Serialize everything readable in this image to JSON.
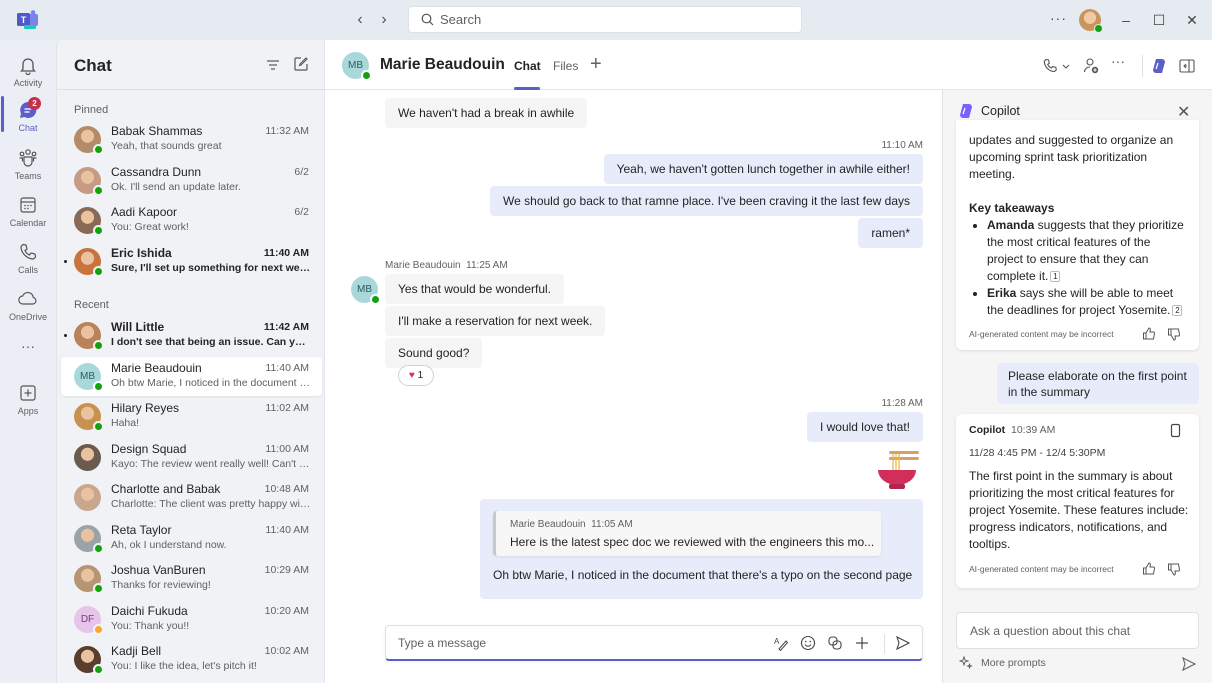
{
  "titlebar": {
    "search_placeholder": "Search",
    "more_label": "···"
  },
  "rail": {
    "items": [
      {
        "id": "activity",
        "label": "Activity",
        "icon": "bell-icon"
      },
      {
        "id": "chat",
        "label": "Chat",
        "icon": "chat-icon",
        "badge": "2",
        "active": true
      },
      {
        "id": "teams",
        "label": "Teams",
        "icon": "teams-icon"
      },
      {
        "id": "calendar",
        "label": "Calendar",
        "icon": "calendar-icon"
      },
      {
        "id": "calls",
        "label": "Calls",
        "icon": "phone-icon"
      },
      {
        "id": "onedrive",
        "label": "OneDrive",
        "icon": "cloud-icon"
      },
      {
        "id": "more",
        "label": "···",
        "icon": "more-icon"
      },
      {
        "id": "apps",
        "label": "Apps",
        "icon": "apps-icon"
      }
    ]
  },
  "chatlist": {
    "title": "Chat",
    "pinned_label": "Pinned",
    "recent_label": "Recent",
    "pinned": [
      {
        "name": "Babak Shammas",
        "time": "11:32 AM",
        "preview": "Yeah, that sounds great",
        "presence": "available"
      },
      {
        "name": "Cassandra Dunn",
        "time": "6/2",
        "preview": "Ok. I'll send an update later.",
        "presence": "available"
      },
      {
        "name": "Aadi Kapoor",
        "time": "6/2",
        "preview": "You: Great work!",
        "presence": "available"
      },
      {
        "name": "Eric Ishida",
        "time": "11:40 AM",
        "preview": "Sure, I'll set up something for next week t...",
        "presence": "available",
        "unread": true
      }
    ],
    "recent": [
      {
        "name": "Will Little",
        "time": "11:42 AM",
        "preview": "I don't see that being an issue. Can you ta...",
        "presence": "available",
        "unread": true
      },
      {
        "name": "Marie Beaudouin",
        "time": "11:40 AM",
        "preview": "Oh btw Marie, I noticed in the document t...",
        "presence": "available",
        "initials": "MB",
        "selected": true
      },
      {
        "name": "Hilary Reyes",
        "time": "11:02 AM",
        "preview": "Haha!",
        "presence": "available"
      },
      {
        "name": "Design Squad",
        "time": "11:00 AM",
        "preview": "Kayo: The review went really well! Can't wai...",
        "presence": "none"
      },
      {
        "name": "Charlotte and Babak",
        "time": "10:48 AM",
        "preview": "Charlotte: The client was pretty happy with...",
        "presence": "none"
      },
      {
        "name": "Reta Taylor",
        "time": "11:40 AM",
        "preview": "Ah, ok I understand now.",
        "presence": "available"
      },
      {
        "name": "Joshua VanBuren",
        "time": "10:29 AM",
        "preview": "Thanks for reviewing!",
        "presence": "available"
      },
      {
        "name": "Daichi Fukuda",
        "time": "10:20 AM",
        "preview": "You: Thank you!!",
        "presence": "away",
        "initials": "DF"
      },
      {
        "name": "Kadji Bell",
        "time": "10:02 AM",
        "preview": "You: I like the idea, let's pitch it!",
        "presence": "available"
      }
    ]
  },
  "conversation": {
    "contact_name": "Marie Beaudouin",
    "contact_initials": "MB",
    "tabs": [
      "Chat",
      "Files"
    ],
    "active_tab": "Chat",
    "messages": {
      "m1": "We haven't had a break in awhile",
      "ts1": "11:10 AM",
      "m2": "Yeah, we haven't gotten lunch together in awhile either!",
      "m3": "We should go back to that ramne place. I've been craving it the last few days",
      "m4": "ramen*",
      "sender2": "Marie Beaudouin",
      "ts2": "11:25 AM",
      "m5": "Yes that would be wonderful.",
      "m6": "I'll make a reservation for next week.",
      "m7": "Sound good?",
      "reaction_count": "1",
      "ts3": "11:28 AM",
      "m8": "I would love that!",
      "quote_sender": "Marie Beaudouin",
      "quote_time": "11:05 AM",
      "quote_text": "Here is the latest spec doc we reviewed with the engineers this mo...",
      "m9": "Oh btw Marie, I noticed in the document that there's a typo on the second page"
    },
    "composer_placeholder": "Type a message"
  },
  "copilot": {
    "title": "Copilot",
    "summary_intro": "updates and suggested to organize an upcoming sprint task prioritization meeting.",
    "key_takeaways_title": "Key takeaways",
    "takeaways": [
      {
        "name": "Amanda",
        "text": " suggests that they prioritize the most critical features of the project to ensure that they can complete it.",
        "cite": "1"
      },
      {
        "name": "Erika",
        "text": " says she will be able to meet the deadlines for project Yosemite.",
        "cite": "2"
      }
    ],
    "disclaimer": "AI-generated content may be incorrect",
    "user_prompt": "Please elaborate on the first point in the summary",
    "response_sender": "Copilot",
    "response_time": "10:39 AM",
    "response_range": "11/28 4:45 PM - 12/4 5:30PM",
    "response_text": "The first point in the summary is about prioritizing the most critical features for project Yosemite. These features include: progress indicators, notifications, and tooltips.",
    "input_placeholder": "Ask a question about this chat",
    "more_prompts": "More prompts"
  }
}
